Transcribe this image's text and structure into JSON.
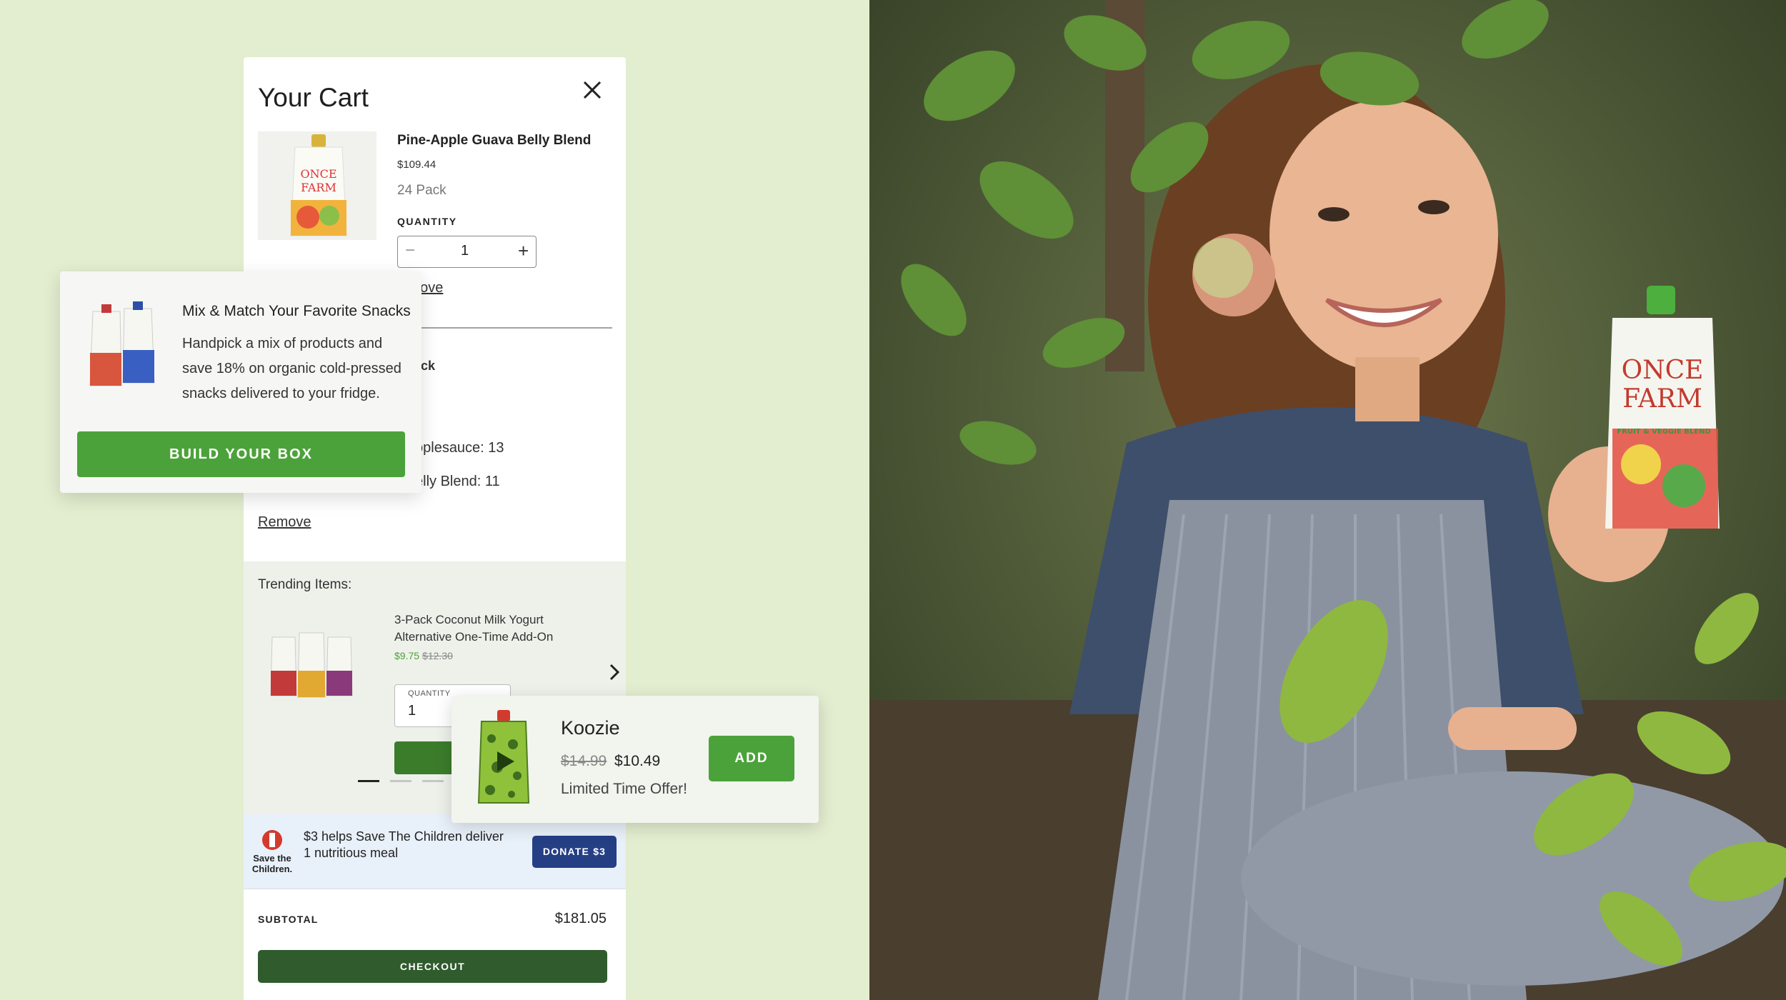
{
  "cart": {
    "title": "Your Cart",
    "item1": {
      "name": "Pine-Apple Guava Belly Blend",
      "price": "$109.44",
      "pack": "24 Pack",
      "quantity_label": "QUANTITY",
      "quantity_value": "1",
      "remove_fragment": "nove"
    },
    "item2": {
      "name_fragment": "ack",
      "line1_fragment": "oplesauce: 13",
      "line2_fragment": "elly Blend: 11",
      "remove_label": "Remove"
    },
    "trending": {
      "title": "Trending Items:",
      "item_name": "3-Pack Coconut Milk Yogurt Alternative One-Time Add-On",
      "price_new": "$9.75",
      "price_old": "$12.30",
      "quantity_label": "QUANTITY",
      "quantity_value": "1"
    },
    "donation": {
      "org_line1": "Save the",
      "org_line2": "Children.",
      "text": "$3 helps Save The Children deliver 1 nutritious meal",
      "button": "DONATE $3"
    },
    "subtotal_label": "SUBTOTAL",
    "subtotal_value": "$181.05",
    "checkout": "CHECKOUT"
  },
  "mix_match": {
    "title": "Mix & Match Your Favorite Snacks",
    "body": "Handpick a mix of products and save 18% on organic cold-pressed snacks delivered to your fridge.",
    "button": "BUILD YOUR BOX"
  },
  "koozie": {
    "title": "Koozie",
    "price_old": "$14.99",
    "price_new": "$10.49",
    "note": "Limited Time Offer!",
    "button": "ADD"
  },
  "photo_pouch": {
    "brand_line1": "ONCE",
    "brand_line2": "FARM",
    "subtitle": "FRUIT & VEGGIE BLEND"
  },
  "colors": {
    "background": "#e3edcf",
    "brand_green": "#4ca23a",
    "checkout_green": "#2f5b2d",
    "donate_navy": "#253f85"
  },
  "icons": [
    "close-icon",
    "minus-icon",
    "plus-icon",
    "chevron-right-icon",
    "save-the-children-logo"
  ]
}
